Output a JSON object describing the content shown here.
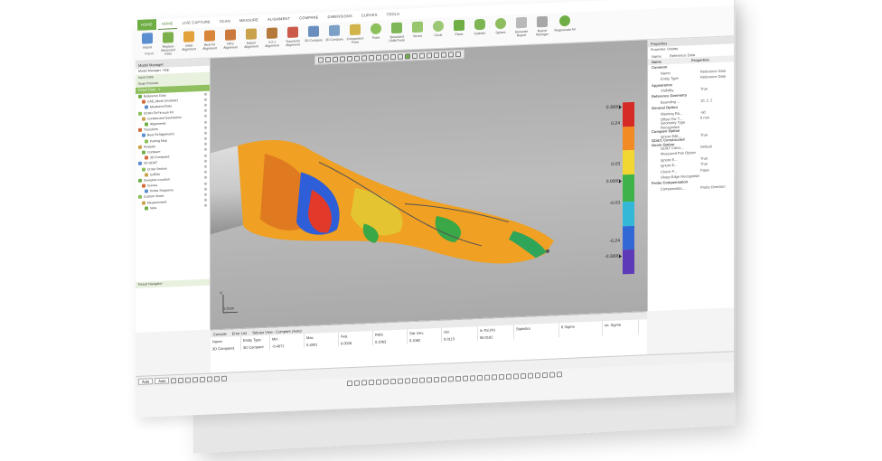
{
  "ribbon": {
    "tabs": [
      "HOME",
      "HOME",
      "LIVE CAPTURE",
      "SCAN",
      "MEASURE",
      "ALIGNMENT",
      "COMPARE",
      "DIMENSIONS",
      "CURVES",
      "TOOLS"
    ],
    "buttons": [
      "Import",
      "Replace Measured Data",
      "Initial Alignment",
      "Best Fit Alignment",
      "RPS Alignment",
      "Datum Alignment",
      "3-2-1 Alignment",
      "Transform Alignment",
      "3D Compare",
      "2D Compare",
      "Comparison Point",
      "Point",
      "Simulated CMM Point",
      "Vector",
      "Circle",
      "Plane",
      "Cylinder",
      "Sphere",
      "Generate Report",
      "Report Manager",
      "Regenerate All"
    ],
    "group_label": "Import"
  },
  "left_panel": {
    "title": "Model Manager",
    "toolbar": [
      "Model Manager",
      "Help"
    ],
    "sections": [
      "Input Data",
      "Scan Process",
      "Result Data - 1"
    ],
    "tree": [
      "Reference Data",
      "CAD_Mesh (modeler)",
      "Measured Data",
      "SCAN Fit Fit scan Fit",
      "Constructed Geometries",
      "Alignments",
      "Transform",
      "Best Fit Alignment1",
      "Pairing Map",
      "Analysis",
      "Compare",
      "3D Compare1",
      "2D GD&T",
      "Cross Section",
      "GdTols",
      "Deviation Location",
      "Curves",
      "Probe Sequence",
      "Custom Views",
      "Measurement",
      "Note"
    ],
    "footer": "Result Navigator"
  },
  "viewport": {
    "colorbar_labels": [
      "0.3000",
      "0.24",
      "0.03",
      "0.0000",
      "-0.03",
      "-0.24",
      "-0.3000"
    ],
    "scale_label": "1.0mm",
    "axis_label": "Y"
  },
  "right_panel": {
    "title": "Properties",
    "tabs": [
      "Properties",
      "Display"
    ],
    "name_label": "Name",
    "name_value": "Reference Data",
    "columns": [
      "Name",
      "Properties"
    ],
    "rows": [
      {
        "k": "Common",
        "v": "",
        "hdr": true
      },
      {
        "k": "Name",
        "v": "Reference Data"
      },
      {
        "k": "Entity Type",
        "v": "Reference Data"
      },
      {
        "k": "Appearance",
        "v": "",
        "hdr": true
      },
      {
        "k": "Visibility",
        "v": "True"
      },
      {
        "k": "Reference Geometry",
        "v": "",
        "hdr": true
      },
      {
        "k": "Bounding ...",
        "v": "10, 2, 2"
      },
      {
        "k": "General Option",
        "v": "",
        "hdr": true
      },
      {
        "k": "Warning Ra...",
        "v": "-50"
      },
      {
        "k": "Offset For T...",
        "v": "0 mm"
      },
      {
        "k": "Geometry Type Recognition",
        "v": ""
      },
      {
        "k": "Compare Option",
        "v": "",
        "hdr": true
      },
      {
        "k": "Ignore Edit...",
        "v": "True"
      },
      {
        "k": "GD&T, Constructed Geom Option",
        "v": "",
        "hdr": true
      },
      {
        "k": "GD&T Calcu...",
        "v": "Default"
      },
      {
        "k": "Measured Pair Option",
        "v": ""
      },
      {
        "k": "Ignore E...",
        "v": "True"
      },
      {
        "k": "Ignore E...",
        "v": "True"
      },
      {
        "k": "Check P...",
        "v": "False"
      },
      {
        "k": "Sharp Edge Recognition",
        "v": ""
      },
      {
        "k": "Probe Compensation",
        "v": "",
        "hdr": true
      },
      {
        "k": "Compensatio...",
        "v": "Probe Direction"
      }
    ]
  },
  "bottom_panel": {
    "tabs": [
      "Console",
      "Error List",
      "Tabular View - Compare (Auto)"
    ],
    "headers": [
      "Name",
      "Entity Type",
      "Min.",
      "Max.",
      "Avg.",
      "RMS",
      "Std. Dev.",
      "Var.",
      "In Tol.(%)",
      "Statistics",
      "6 Sigma",
      "Int. Sigma"
    ],
    "row": [
      "3D Compare1",
      "3D Compare",
      "-0.4871",
      "0.4901",
      "0.0026",
      "0.1063",
      "0.1062",
      "0.0113",
      "98.0182",
      "",
      "",
      ""
    ]
  },
  "statusbar": {
    "selector1": "Auto",
    "selector2": "Auto"
  },
  "colors": {
    "accent": "#6fae45",
    "viewport_bg": "#b4b4b4"
  }
}
